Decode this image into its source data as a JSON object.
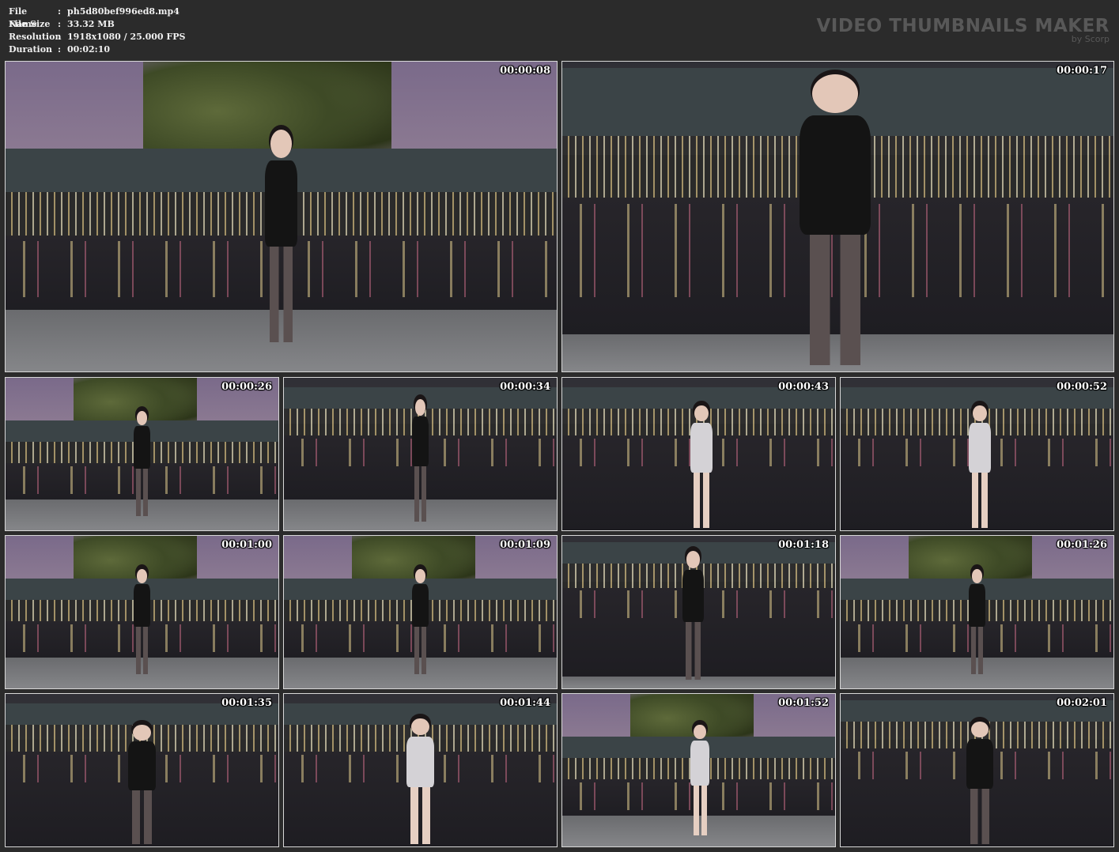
{
  "info": {
    "file_name_label": "File Name",
    "file_name": "ph5d80bef996ed8.mp4",
    "file_size_label": "File Size",
    "file_size": "33.32 MB",
    "resolution_label": "Resolution",
    "resolution": "1918x1080 / 25.000 FPS",
    "duration_label": "Duration",
    "duration": "00:02:10",
    "colon": ":"
  },
  "logo": {
    "title": "VIDEO THUMBNAILS MAKER",
    "subtitle": "by Scorp"
  },
  "thumbnails": [
    {
      "time": "00:00:08"
    },
    {
      "time": "00:00:17"
    },
    {
      "time": "00:00:26"
    },
    {
      "time": "00:00:34"
    },
    {
      "time": "00:00:43"
    },
    {
      "time": "00:00:52"
    },
    {
      "time": "00:01:00"
    },
    {
      "time": "00:01:09"
    },
    {
      "time": "00:01:18"
    },
    {
      "time": "00:01:26"
    },
    {
      "time": "00:01:35"
    },
    {
      "time": "00:01:44"
    },
    {
      "time": "00:01:52"
    },
    {
      "time": "00:02:01"
    }
  ]
}
